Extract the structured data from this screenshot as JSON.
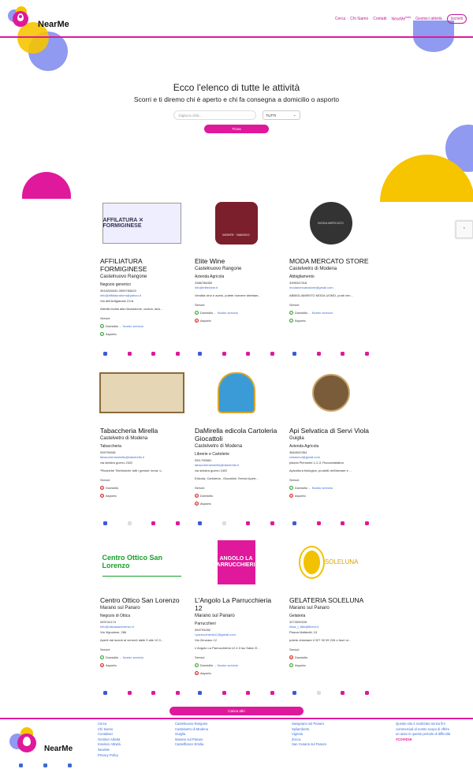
{
  "brand": {
    "name": "NearMe"
  },
  "nav": {
    "items": [
      "Cerca",
      "Chi Siamo",
      "Contatti",
      "NearMe",
      "Gestisci attività"
    ],
    "beta": "beta",
    "register": "Iscriviti"
  },
  "hero": {
    "title": "Ecco l'elenco di tutte le attività",
    "subtitle": "Scorri e ti diremo chi è aperto e chi fa consegna a domicilio o asporto",
    "search_placeholder": "Digita la città...",
    "select_value": "TUTTI",
    "search_button": "Trova"
  },
  "labels": {
    "services": "Servizi:",
    "delivery": "Domicilio",
    "our_service": "Nostro servizio",
    "takeaway": "Asporto"
  },
  "cards": [
    {
      "title": "AFFILIATURA FORMIGINESE",
      "city": "Castelnuovo Rangone",
      "category": "Negozio generico",
      "phone": "3515206632-0599783620",
      "email": "info@affilaturaform@yahoo.it",
      "address": "Via dell'Artigianato 21/A",
      "desc": "Attività rivolta alla ristorazione, cucina, lavo...",
      "delivery": true,
      "delivery_own": true,
      "takeaway": true
    },
    {
      "title": "Elite Wine",
      "city": "Castelnuovo Rangone",
      "category": "Azienda Agricola",
      "phone": "3386788450",
      "email": "info@elitewine.it",
      "address": "",
      "desc": "Vendita vino e aceto, potete ricevere direttam...",
      "delivery": true,
      "delivery_own": true,
      "takeaway": false
    },
    {
      "title": "MODA MERCATO STORE",
      "city": "Castelvetro di Modena",
      "category": "Abbigliamento",
      "phone": "3395347018",
      "email": "modamercatostore@gmail.com",
      "address": "",
      "desc": "ABBIGLIAMENTO MODA UOMO, punti ven...",
      "delivery": true,
      "delivery_own": true,
      "takeaway": true
    },
    {
      "title": "Tabaccheria Mirella",
      "city": "Castelvetro di Modena",
      "category": "Tabaccheria",
      "phone": "059790681",
      "email": "tabaccheriamirella@damirella.it",
      "address": "via sinistra guerro 24/D",
      "desc": "*Ricariche Telefoniche tutti i gestori: kena, v...",
      "delivery": false,
      "delivery_own": false,
      "takeaway": false
    },
    {
      "title": "DaMirella edicola Cartoleria Giocattoli",
      "city": "Castelvetro di Modena",
      "category": "Librerie e Cartolerie",
      "phone": "059-790681",
      "email": "tabaccheriamirella@damirella.it",
      "address": "via sinistra guerro 24/D",
      "desc": "Edicola, Cartoleria , Giocattoli, Servizi Apert...",
      "delivery": false,
      "delivery_own": false,
      "takeaway": false
    },
    {
      "title": "Api Selvatica di Servi Viola",
      "city": "Guiglia",
      "category": "Azienda Agricola",
      "phone": "3664092354",
      "email": "violaservi@gmail.com",
      "address": "piazza Piemonte 1-2-3, Roccamalatina",
      "desc": "Apicoltura biologica, prodotti dell'alveare e ...",
      "delivery": true,
      "delivery_own": true,
      "takeaway": false
    },
    {
      "title": "Centro Ottico San Lorenzo",
      "city": "Marano sul Panaro",
      "category": "Negozio di Ottica",
      "phone": "059744174",
      "email": "info@otticasanlorenzo.it",
      "address": "Via Vignolese, 286",
      "desc": "Aperti dal lunedì al venerdì dalle 9 alle 12:3...",
      "delivery": true,
      "delivery_own": true,
      "takeaway": false
    },
    {
      "title": "L'Angolo La Parrucchieria 12",
      "city": "Marano sul Panaro",
      "category": "Parrucchieri",
      "phone": "059793282",
      "email": "l.parrucchieria12@gmail.com",
      "address": "Via Zenzano 12",
      "desc": "L'Angolo La Parrucchieria 12 è il tuo Salon E...",
      "delivery": true,
      "delivery_own": true,
      "takeaway": false
    },
    {
      "title": "GELATERIA SOLELUNA",
      "city": "Marano sul Panaro",
      "category": "Gelateria",
      "phone": "3273099226",
      "email": "elisa_t_88a@libero.it",
      "address": "Piazza Matteotti, 15",
      "desc": "potete chiamare il 327 30 99 226 o fuori or...",
      "delivery": false,
      "delivery_own": false,
      "takeaway": true
    }
  ],
  "load_more": "Carica altri",
  "footer": {
    "col1": [
      "Cerca",
      "Chi Siamo",
      "Contattaci",
      "Gestisci Attività",
      "Inserisci Attività",
      "NearMe",
      "Privacy Policy"
    ],
    "col2": [
      "Castelnuovo Rangone",
      "Castelvetro di Modena",
      "Guiglia",
      "Marano sul Panaro",
      "Castelfranco Emilia"
    ],
    "col3": [
      "Savignano sul Panaro",
      "Spilamberto",
      "Vignola",
      "Zocca",
      "San Cesario sul Panaro"
    ],
    "col4": [
      "Questo sito è realizzato senza fini",
      "commerciali al nostro scopo di offrire",
      "un aiuto in questo periodo di difficoltà"
    ],
    "hashtag": "#COVID19"
  },
  "colors": {
    "accent": "#e0189b",
    "link": "#3a6bd6",
    "yellow": "#f7c400",
    "lavender": "#8f9af0"
  }
}
